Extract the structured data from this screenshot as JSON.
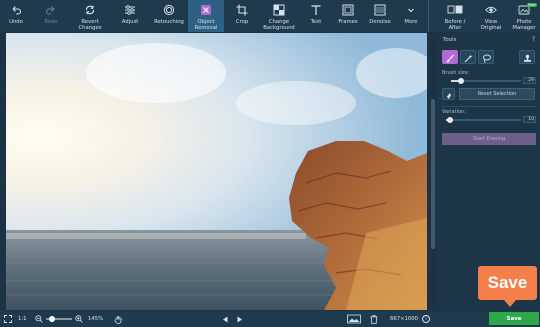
{
  "colors": {
    "accent": "#b06ad6",
    "toolbar_bg": "#1f3a4c",
    "active_tool": "#2d6082",
    "save_green": "#2ea84a",
    "callout_orange": "#f47f4a"
  },
  "toolbar": {
    "items": [
      {
        "label": "Undo",
        "icon": "undo-icon",
        "state": "normal"
      },
      {
        "label": "Redo",
        "icon": "redo-icon",
        "state": "disabled"
      },
      {
        "label": "Revert\nChanges",
        "icon": "revert-icon",
        "state": "normal"
      },
      {
        "label": "Adjust",
        "icon": "adjust-icon",
        "state": "normal"
      },
      {
        "label": "Retouching",
        "icon": "retouching-icon",
        "state": "normal"
      },
      {
        "label": "Object\nRemoval",
        "icon": "object-removal-icon",
        "state": "active"
      },
      {
        "label": "Crop",
        "icon": "crop-icon",
        "state": "normal"
      },
      {
        "label": "Change\nBackground",
        "icon": "change-background-icon",
        "state": "normal"
      },
      {
        "label": "Text",
        "icon": "text-icon",
        "state": "normal"
      },
      {
        "label": "Frames",
        "icon": "frames-icon",
        "state": "normal"
      },
      {
        "label": "Denoise",
        "icon": "denoise-icon",
        "state": "normal"
      },
      {
        "label": "More",
        "icon": "chevron-down-icon",
        "state": "normal"
      }
    ],
    "right_items": [
      {
        "label": "Before /\nAfter",
        "icon": "before-after-icon"
      },
      {
        "label": "View\nOriginal",
        "icon": "eye-icon"
      },
      {
        "label": "Photo\nManager",
        "icon": "photo-manager-icon"
      }
    ],
    "new_badge": "New"
  },
  "panel": {
    "title": "Tools",
    "help": "?",
    "brush_size_label": "Brush size:",
    "brush_size_value": "29",
    "brush_size_level": 0.14,
    "reset_selection": "Reset Selection",
    "variation_label": "Variation:",
    "variation_value": "10",
    "variation_level": 0.05,
    "start_erasing": "Start Erasing"
  },
  "bottombar": {
    "fit_label": "1:1",
    "zoom": "145%",
    "dimensions": "667×1000",
    "info": "i"
  },
  "save": {
    "label": "Save",
    "callout": "Save"
  }
}
